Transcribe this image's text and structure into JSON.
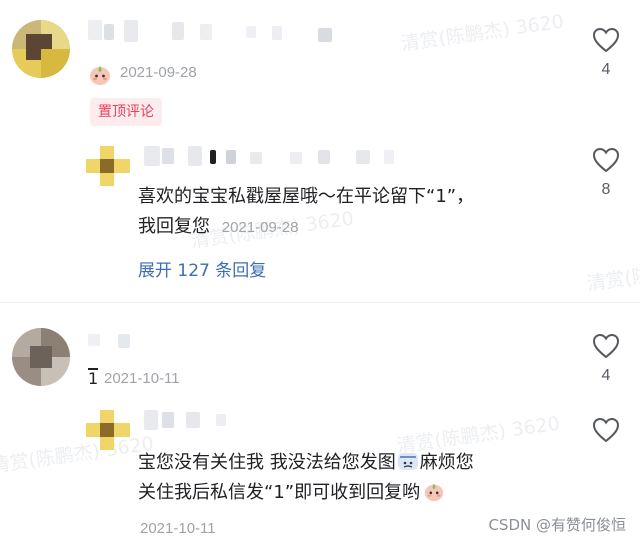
{
  "watermark": {
    "text": "清赏(陈鹏杰) 3620",
    "text2": "清赏(陈鹏杰) 3620"
  },
  "comment1": {
    "date": "2021-09-28",
    "likes": "4",
    "pinned_label": "置顶评论"
  },
  "reply1": {
    "text_line1": "喜欢的宝宝私戳屋屋哦～在平论留下“1”，",
    "text_line2": "我回复您",
    "date": "2021-09-28",
    "likes": "8",
    "expand_label": "展开 127 条回复"
  },
  "comment2": {
    "text_fragment": "1",
    "date": "2021-10-11",
    "likes": "4"
  },
  "reply2": {
    "text_line1a": "宝您没有关住我 我没法给您发图",
    "text_line1b": "麻烦您",
    "text_line2": "关住我后私信发“1”即可收到回复哟",
    "date": "2021-10-11"
  },
  "footer": {
    "source": "CSDN @有赞何俊恒"
  },
  "colors": {
    "accent_red": "#ef3d5a",
    "link_blue": "#3c6eb4",
    "meta_gray": "#a0a3a8"
  },
  "icons": [
    "like-heart-icon",
    "peach-emoji-icon",
    "pixel-avatar",
    "blurred-name"
  ]
}
